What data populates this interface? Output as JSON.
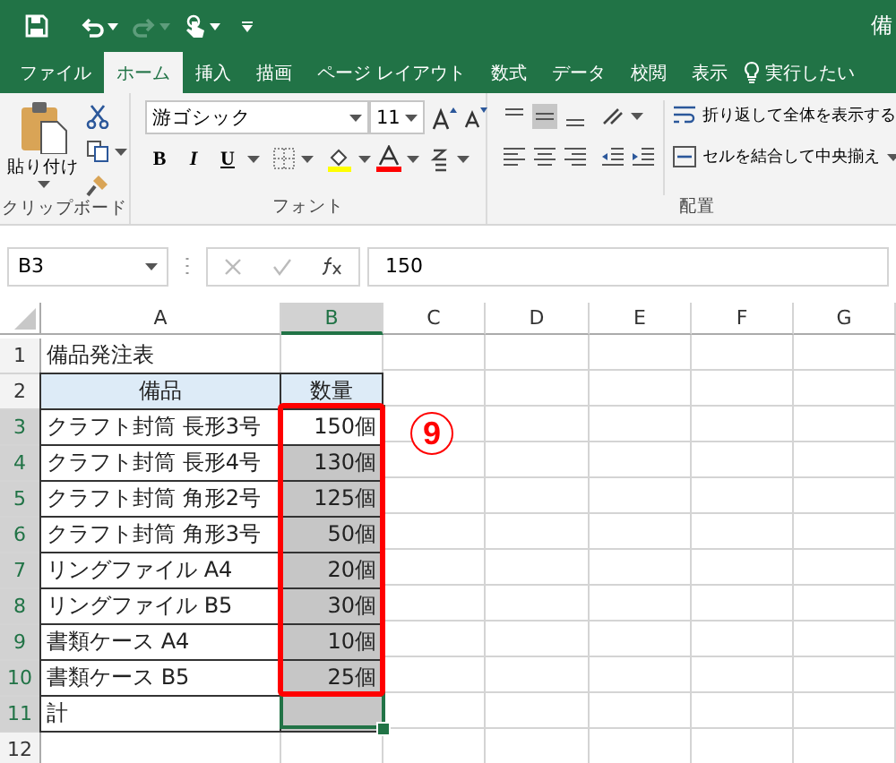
{
  "title_bar": {
    "title": "備"
  },
  "tabs": [
    {
      "label": "ファイル",
      "selected": false
    },
    {
      "label": "ホーム",
      "selected": true
    },
    {
      "label": "挿入",
      "selected": false
    },
    {
      "label": "描画",
      "selected": false
    },
    {
      "label": "ページ レイアウト",
      "selected": false
    },
    {
      "label": "数式",
      "selected": false
    },
    {
      "label": "データ",
      "selected": false
    },
    {
      "label": "校閲",
      "selected": false
    },
    {
      "label": "表示",
      "selected": false
    }
  ],
  "tell_me": {
    "placeholder": "実行したい"
  },
  "ribbon": {
    "clipboard": {
      "paste_label": "貼り付け",
      "group_label": "クリップボード"
    },
    "font": {
      "font_name": "游ゴシック",
      "font_size": "11",
      "bold": "B",
      "italic": "I",
      "underline": "U",
      "group_label": "フォント"
    },
    "alignment": {
      "wrap_text": "折り返して全体を表示する",
      "merge_center": "セルを結合して中央揃え",
      "group_label": "配置"
    }
  },
  "formula_bar": {
    "name_box": "B3",
    "value": "150"
  },
  "columns": [
    {
      "label": "A",
      "selected": false
    },
    {
      "label": "B",
      "selected": true
    },
    {
      "label": "C",
      "selected": false
    },
    {
      "label": "D",
      "selected": false
    },
    {
      "label": "E",
      "selected": false
    },
    {
      "label": "F",
      "selected": false
    },
    {
      "label": "G",
      "selected": false
    }
  ],
  "rows": [
    {
      "number": "1",
      "selected": false,
      "kind": "title",
      "cells": [
        {
          "text": "備品発注表"
        },
        {
          "selected": false
        }
      ]
    },
    {
      "number": "2",
      "selected": false,
      "kind": "header",
      "cells": [
        {
          "text": "備品"
        },
        {
          "text": "数量",
          "selected": false
        }
      ]
    },
    {
      "number": "3",
      "selected": true,
      "kind": "data",
      "cells": [
        {
          "text": "クラフト封筒 長形3号"
        },
        {
          "text": "150個",
          "selected": true,
          "active": true
        }
      ]
    },
    {
      "number": "4",
      "selected": true,
      "kind": "data",
      "cells": [
        {
          "text": "クラフト封筒 長形4号"
        },
        {
          "text": "130個",
          "selected": true
        }
      ]
    },
    {
      "number": "5",
      "selected": true,
      "kind": "data",
      "cells": [
        {
          "text": "クラフト封筒 角形2号"
        },
        {
          "text": "125個",
          "selected": true
        }
      ]
    },
    {
      "number": "6",
      "selected": true,
      "kind": "data",
      "cells": [
        {
          "text": "クラフト封筒 角形3号"
        },
        {
          "text": "50個",
          "selected": true
        }
      ]
    },
    {
      "number": "7",
      "selected": true,
      "kind": "data",
      "cells": [
        {
          "text": "リングファイル A4"
        },
        {
          "text": "20個",
          "selected": true
        }
      ]
    },
    {
      "number": "8",
      "selected": true,
      "kind": "data",
      "cells": [
        {
          "text": "リングファイル B5"
        },
        {
          "text": "30個",
          "selected": true
        }
      ]
    },
    {
      "number": "9",
      "selected": true,
      "kind": "data",
      "cells": [
        {
          "text": "書類ケース A4"
        },
        {
          "text": "10個",
          "selected": true
        }
      ]
    },
    {
      "number": "10",
      "selected": true,
      "kind": "data",
      "cells": [
        {
          "text": "書類ケース B5"
        },
        {
          "text": "25個",
          "selected": true
        }
      ]
    },
    {
      "number": "11",
      "selected": true,
      "kind": "data",
      "cells": [
        {
          "text": "計"
        },
        {
          "selected": true
        }
      ]
    },
    {
      "number": "12",
      "selected": false,
      "kind": "blank",
      "cells": []
    }
  ],
  "annotation": {
    "step": "9"
  }
}
